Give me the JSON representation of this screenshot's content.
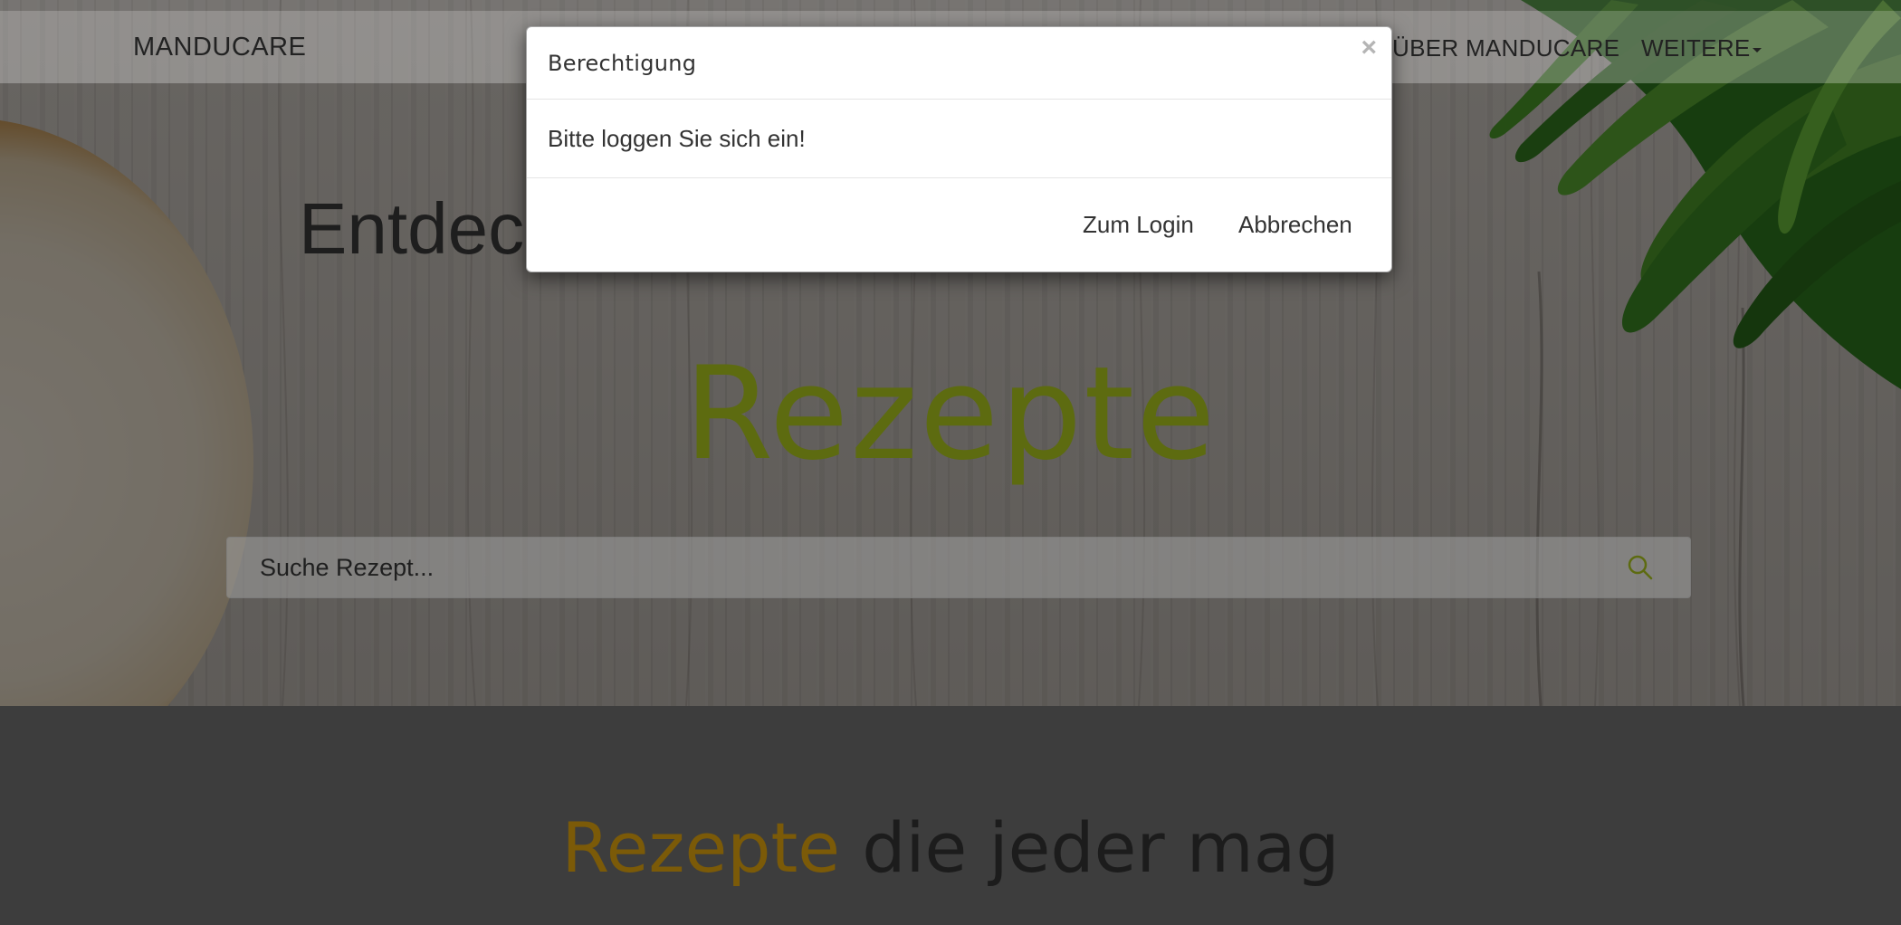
{
  "navbar": {
    "brand": "MANDUCARE",
    "links": [
      {
        "label": "ÜBER MANDUCARE"
      },
      {
        "label": "WEITERE"
      }
    ]
  },
  "hero": {
    "heading": "Entdec",
    "title": "Rezepte",
    "search": {
      "placeholder": "Suche Rezept...",
      "value": ""
    }
  },
  "section": {
    "title_accent": "Rezepte",
    "title_rest": "die jeder mag"
  },
  "modal": {
    "title": "Berechtigung",
    "close": "×",
    "message": "Bitte loggen Sie sich ein!",
    "buttons": {
      "login": "Zum Login",
      "cancel": "Abbrechen"
    }
  },
  "colors": {
    "title_green": "#5d6b10",
    "accent_gold": "#7b5a08",
    "search_icon": "#5d6b10"
  },
  "icons": {
    "search": "search-icon",
    "close": "close-icon",
    "dropdown": "caret-down-icon"
  }
}
